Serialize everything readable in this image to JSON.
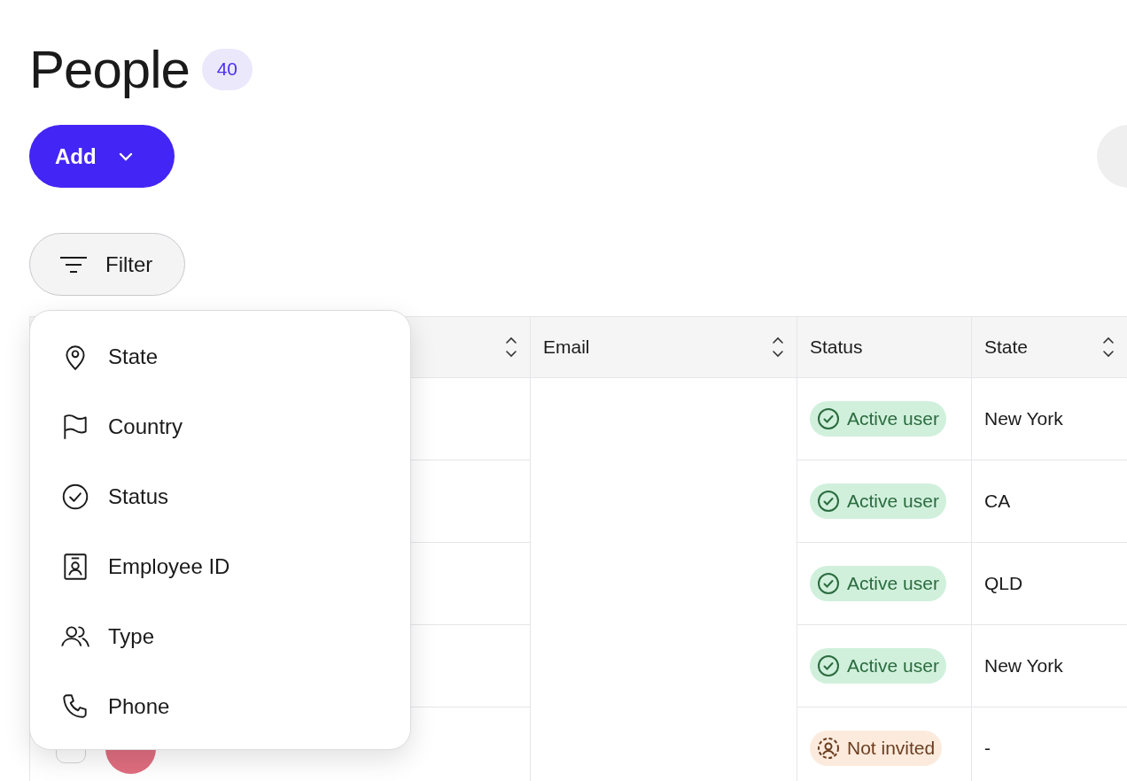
{
  "page": {
    "title": "People",
    "count": "40"
  },
  "add_button": {
    "label": "Add"
  },
  "filter_button": {
    "label": "Filter"
  },
  "table": {
    "columns": [
      {
        "sortable": true
      },
      {
        "label": "Email",
        "sortable": true
      },
      {
        "label": "Status",
        "sortable": false
      },
      {
        "label": "State",
        "sortable": true
      }
    ],
    "rows": [
      {
        "status": {
          "label": "Active user",
          "kind": "active"
        },
        "state": "New York"
      },
      {
        "status": {
          "label": "Active user",
          "kind": "active"
        },
        "state": "CA"
      },
      {
        "status": {
          "label": "Active user",
          "kind": "active"
        },
        "state": "QLD"
      },
      {
        "status": {
          "label": "Active user",
          "kind": "active"
        },
        "state": "New York"
      },
      {
        "person": {
          "color": "#df6d7f"
        },
        "checked": false,
        "status": {
          "label": "Not invited",
          "kind": "not_invited"
        },
        "state": "-"
      }
    ]
  },
  "filter_menu": {
    "items": [
      {
        "label": "State"
      },
      {
        "label": "Country"
      },
      {
        "label": "Status"
      },
      {
        "label": "Employee ID"
      },
      {
        "label": "Type"
      },
      {
        "label": "Phone"
      }
    ]
  }
}
